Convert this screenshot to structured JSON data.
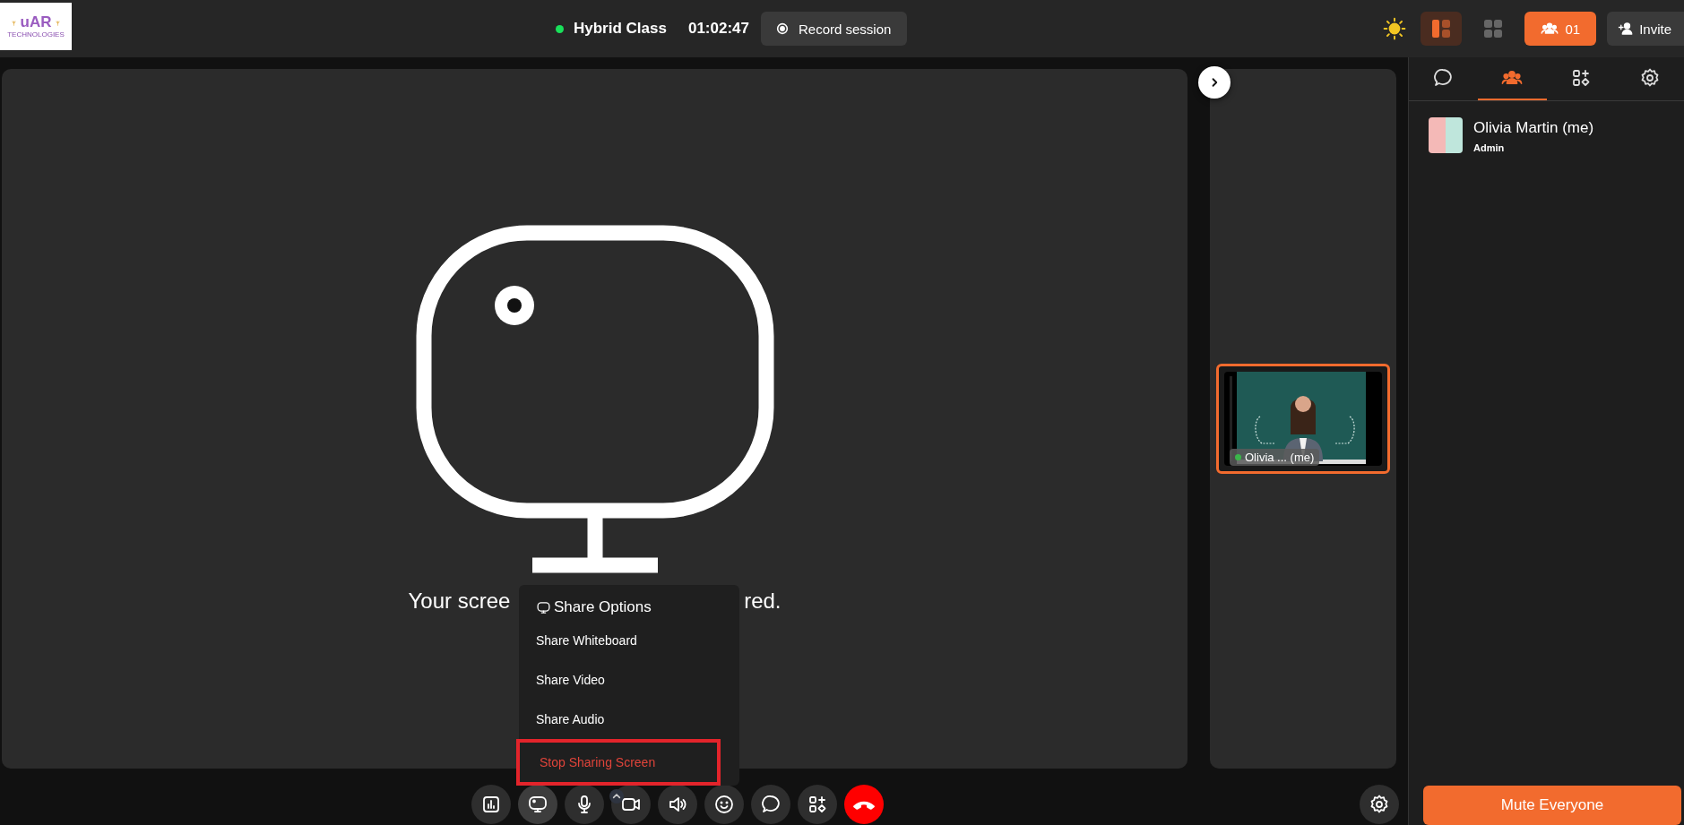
{
  "logo": {
    "mark": "uAR",
    "name": "TECHNOLOGIES"
  },
  "header": {
    "live": true,
    "class_title": "Hybrid Class",
    "timer": "01:02:47",
    "record_button": "Record session",
    "layouts": [
      {
        "kind": "speaker",
        "selected": true
      },
      {
        "kind": "grid",
        "selected": false
      }
    ],
    "participants_button": "01",
    "invite_button": "Invite"
  },
  "stage": {
    "message_start": "Your scree",
    "message_end": "red."
  },
  "share_menu": {
    "title": "Share Options",
    "items": [
      {
        "label": "Share Whiteboard",
        "kind": "option",
        "highlighted": false
      },
      {
        "label": "Share Video",
        "kind": "option",
        "highlighted": false
      },
      {
        "label": "Share Audio",
        "kind": "option",
        "highlighted": false
      },
      {
        "label": "Stop Sharing Screen",
        "kind": "stop",
        "highlighted": true
      }
    ]
  },
  "tiles": [
    {
      "name": "Olivia ... (me)",
      "online": true,
      "selected": true
    }
  ],
  "toolbar": [
    {
      "kind": "stats",
      "active": false
    },
    {
      "kind": "screen",
      "active": true
    },
    {
      "kind": "mic",
      "active": false
    },
    {
      "kind": "camera",
      "active": false
    },
    {
      "kind": "speaker",
      "active": false
    },
    {
      "kind": "emoji",
      "active": false
    },
    {
      "kind": "chat",
      "active": false
    },
    {
      "kind": "apps",
      "active": false
    },
    {
      "kind": "end",
      "active": false
    }
  ],
  "side_tabs": [
    {
      "kind": "chat",
      "selected": false
    },
    {
      "kind": "people",
      "selected": true
    },
    {
      "kind": "apps",
      "selected": false
    },
    {
      "kind": "settings",
      "selected": false
    }
  ],
  "participants": [
    {
      "name": "Olivia Martin (me)",
      "role": "Admin"
    }
  ],
  "mute_button": "Mute Everyone"
}
